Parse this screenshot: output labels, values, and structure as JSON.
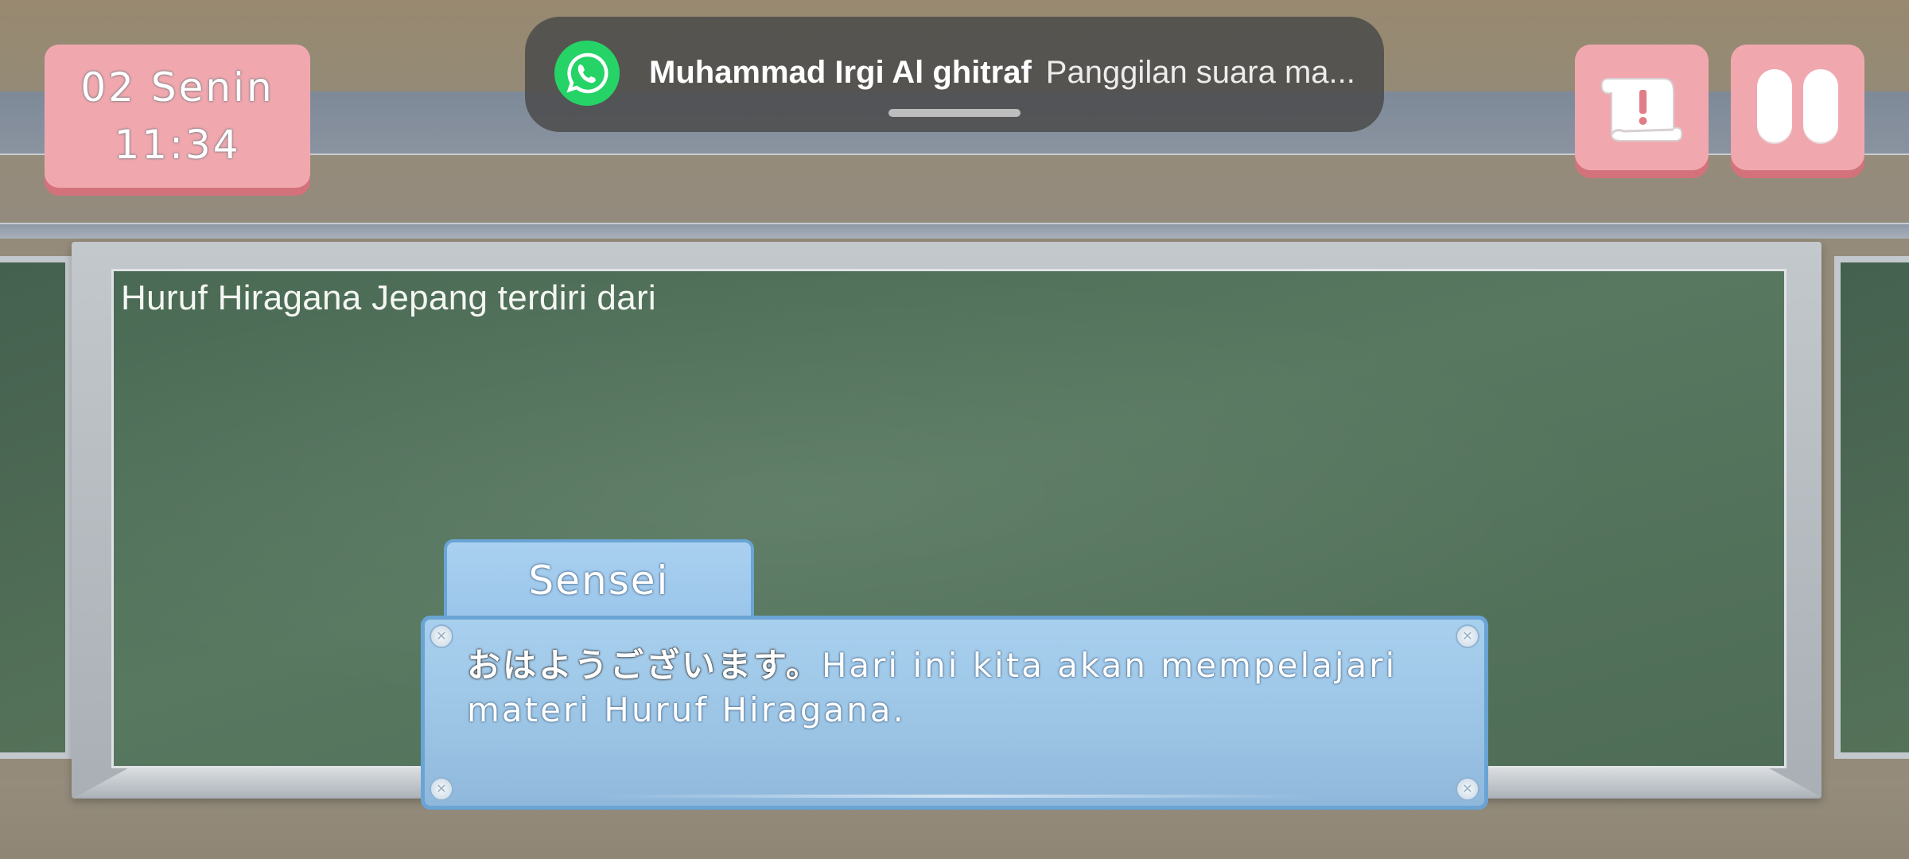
{
  "hud": {
    "date_label": "02 Senin",
    "time_label": "11:34"
  },
  "notification": {
    "app_icon": "whatsapp-icon",
    "sender": "Muhammad Irgi Al ghitraf",
    "message": "Panggilan suara ma..."
  },
  "board": {
    "text": "Huruf Hiragana Jepang terdiri dari"
  },
  "dialog": {
    "speaker": "Sensei",
    "text_japanese": "おはようございます。",
    "text": "Hari ini kita akan mempelajari materi Huruf Hiragana."
  },
  "buttons": {
    "quest_icon": "scroll-exclamation-icon",
    "pause_icon": "pause-icon"
  },
  "colors": {
    "hud_pink": "#f0a8ae",
    "hud_pink_shadow": "#d4727c",
    "dialog_blue": "#9dc6e6",
    "dialog_border": "#6aa4d4",
    "chalkboard_green": "#587860",
    "whatsapp_green": "#25d366"
  }
}
